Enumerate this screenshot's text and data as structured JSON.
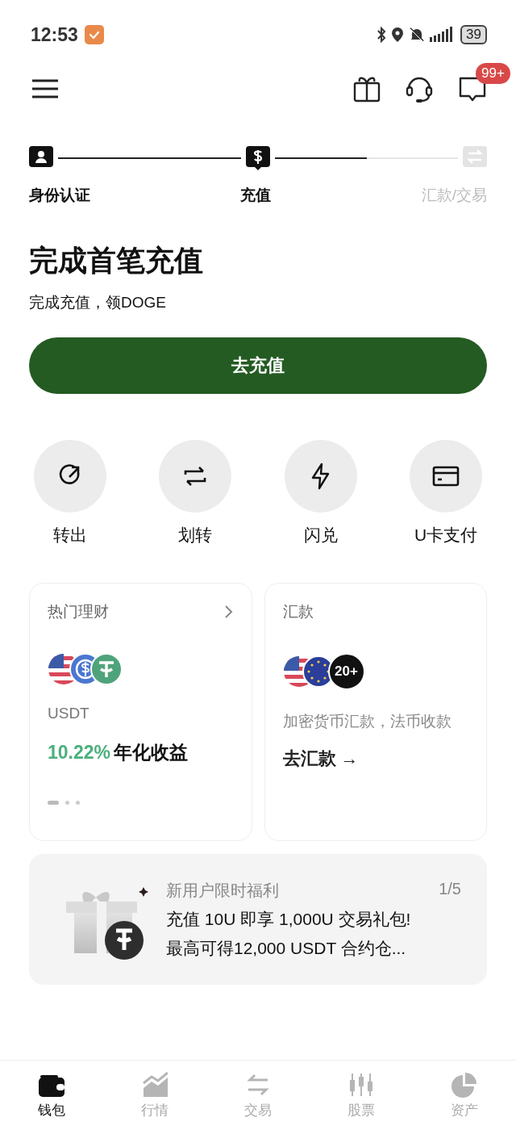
{
  "status_bar": {
    "time": "12:53",
    "battery": "39"
  },
  "header": {
    "badge": "99+"
  },
  "stepper": {
    "steps": [
      {
        "label": "身份认证",
        "reached": true
      },
      {
        "label": "充值",
        "reached": true
      },
      {
        "label": "汇款/交易",
        "reached": false
      }
    ],
    "segments": [
      {
        "level": 1
      },
      {
        "level": 0.5
      }
    ]
  },
  "task": {
    "title": "完成首笔充值",
    "subtitle": "完成充值，领DOGE",
    "button": "去充值"
  },
  "actions": [
    {
      "label": "转出",
      "kind": "send"
    },
    {
      "label": "划转",
      "kind": "transfer"
    },
    {
      "label": "闪兑",
      "kind": "flash"
    },
    {
      "label": "U卡支付",
      "kind": "card"
    }
  ],
  "earn_card": {
    "title": "热门理财",
    "asset": "USDT",
    "rate": "10.22%",
    "rate_label": "年化收益",
    "pager": [
      {
        "selected": true
      },
      {
        "selected": false
      },
      {
        "selected": false
      }
    ]
  },
  "remit_card": {
    "title": "汇款",
    "more": "20+",
    "description": "加密货币汇款，法币收款",
    "link": "去汇款 →"
  },
  "promo": {
    "title": "新用户限时福利",
    "counter": "1/5",
    "lines": [
      "充值 10U 即享 1,000U 交易礼包!",
      "最高可得12,000 USDT 合约仓..."
    ]
  },
  "bottom_nav": [
    {
      "label": "钱包",
      "kind": "wallet",
      "selected": true
    },
    {
      "label": "行情",
      "kind": "market",
      "selected": false
    },
    {
      "label": "交易",
      "kind": "trade",
      "selected": false
    },
    {
      "label": "股票",
      "kind": "stocks",
      "selected": false
    },
    {
      "label": "资产",
      "kind": "assets",
      "selected": false
    }
  ]
}
